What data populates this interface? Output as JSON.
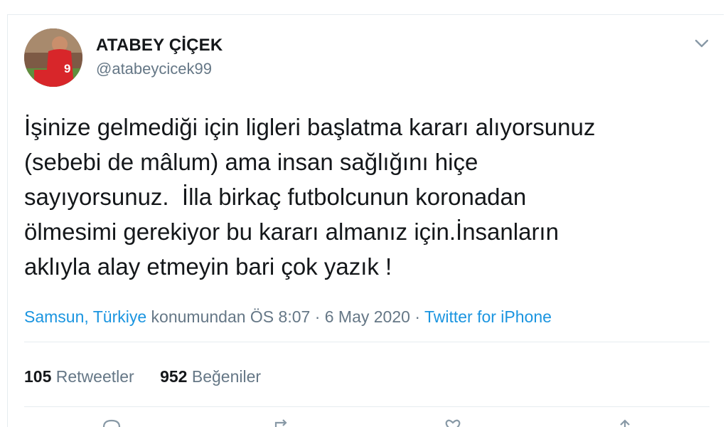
{
  "user": {
    "display_name": "ATABEY ÇİÇEK",
    "handle": "@atabeycicek99"
  },
  "tweet": {
    "text": "İşinize gelmediği için ligleri başlatma kararı alıyorsunuz\n(sebebi de mâlum) ama insan sağlığını hiçe\nsayıyorsunuz.  İlla birkaç futbolcunun koronadan\nölmesimi gerekiyor bu kararı almanız için.İnsanların\naklıyla alay etmeyin bari çok yazık !",
    "location": "Samsun, Türkiye",
    "location_suffix": " konumundan ÖS 8:07 · 6 May 2020 · ",
    "source": "Twitter for iPhone"
  },
  "stats": {
    "retweets_count": "105",
    "retweets_label": " Retweetler",
    "likes_count": "952",
    "likes_label": " Beğeniler"
  },
  "icons": {
    "caret": "chevron-down-icon",
    "reply": "reply-icon",
    "retweet": "retweet-icon",
    "like": "heart-icon",
    "share": "share-icon"
  },
  "colors": {
    "link": "#1b95e0",
    "text": "#14171a",
    "muted": "#657786",
    "divider": "#e6ecf0"
  }
}
